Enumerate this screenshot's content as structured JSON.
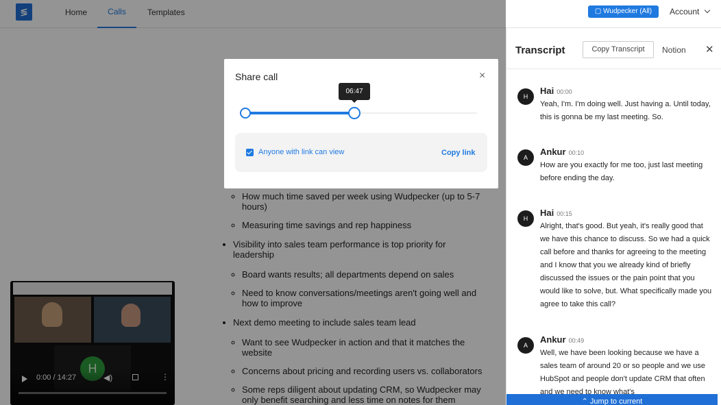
{
  "nav": {
    "logo_glyph": "≶",
    "home": "Home",
    "calls": "Calls",
    "templates": "Templates",
    "workspace": "Wudpecker (All)",
    "account": "Account"
  },
  "notes": {
    "items": [
      {
        "text": "",
        "children": [
          "How much time saved per week using Wudpecker (up to 5-7 hours)",
          "Measuring time savings and rep happiness"
        ]
      },
      {
        "text": "Visibility into sales team performance is top priority for leadership",
        "children": [
          "Board wants results; all departments depend on sales",
          "Need to know conversations/meetings aren't going well and how to improve"
        ]
      },
      {
        "text": "Next demo meeting to include sales team lead",
        "children": [
          "Want to see Wudpecker in action and that it matches the website",
          "Concerns about pricing and recording users vs. collaborators",
          "Some reps diligent about updating CRM, so Wudpecker may only benefit searching and less time on notes for them"
        ]
      }
    ]
  },
  "video": {
    "avatar_letter": "H",
    "time": "0:00 / 14:27",
    "progress": 0
  },
  "modal": {
    "title": "Share call",
    "close": "×",
    "tooltip_time": "06:47",
    "range_end_fraction": 0.47,
    "checkbox_label": "Anyone with link can view",
    "checkbox_checked": true,
    "copy_link": "Copy link"
  },
  "transcript": {
    "title": "Transcript",
    "copy_button": "Copy Transcript",
    "notion": "Notion",
    "close": "✕",
    "jump": "Jump to current",
    "entries": [
      {
        "avatar": "H",
        "name": "Hai",
        "time": "00:00",
        "text": "Yeah, I'm. I'm doing well. Just having a. Until today, this is gonna be my last meeting. So."
      },
      {
        "avatar": "A",
        "name": "Ankur",
        "time": "00:10",
        "text": "How are you exactly for me too, just last meeting before ending the day."
      },
      {
        "avatar": "H",
        "name": "Hai",
        "time": "00:15",
        "text": "Alright, that's good. But yeah, it's really good that we have this chance to discuss. So we had a quick call before and thanks for agreeing to the meeting and I know that you we already kind of briefly discussed the issues or the pain point that you would like to solve, but. What specifically made you agree to take this call?"
      },
      {
        "avatar": "A",
        "name": "Ankur",
        "time": "00:49",
        "text": "Well, we have been looking because we have a sales team of around 20 or so people and we use HubSpot and people don't update CRM that often and we need to know what's"
      }
    ]
  },
  "colors": {
    "accent": "#1f7ae0",
    "avatar_green": "#2e9e3d"
  }
}
